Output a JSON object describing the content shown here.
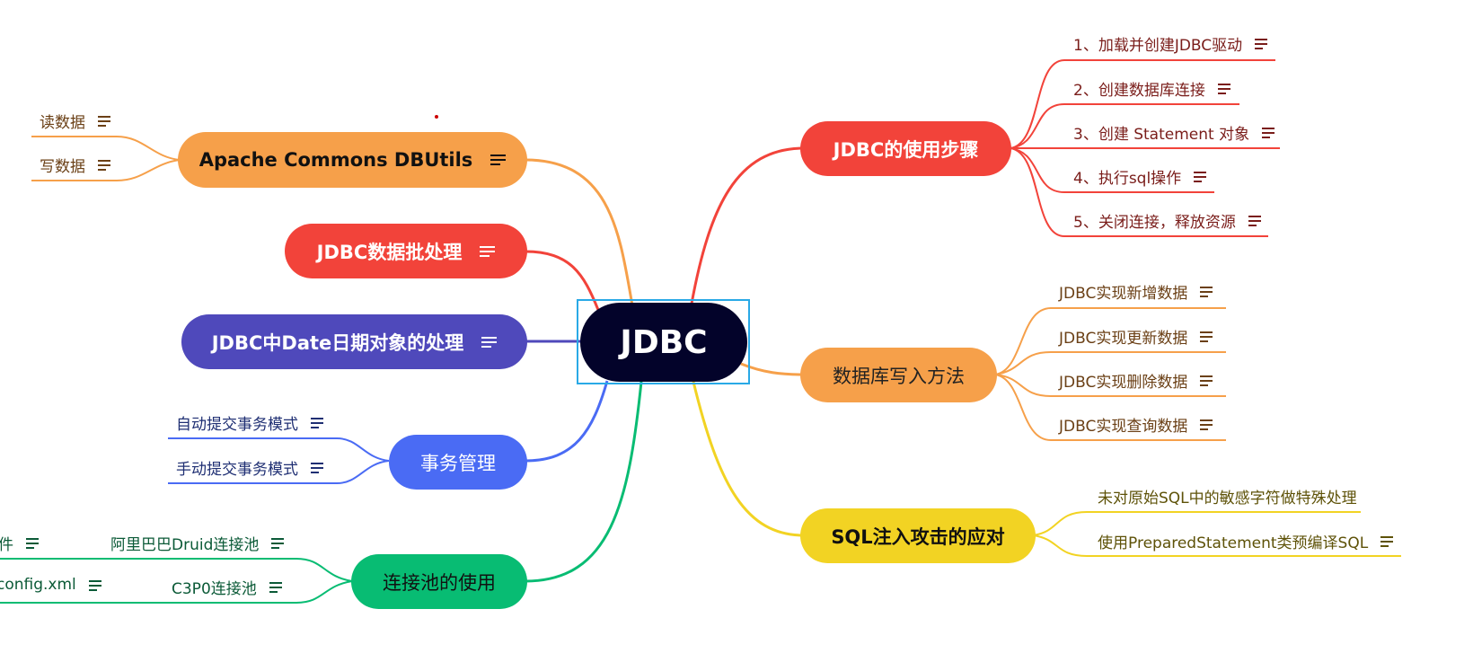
{
  "root": {
    "label": "JDBC",
    "color": "#03032a"
  },
  "branches": {
    "steps": {
      "label": "JDBC的使用步骤",
      "color": "#f2433a",
      "leaves": [
        "1、加载并创建JDBC驱动",
        "2、创建数据库连接",
        "3、创建 Statement 对象",
        "4、执行sql操作",
        "5、关闭连接，释放资源"
      ]
    },
    "write": {
      "label": "数据库写入方法",
      "color": "#f6a04a",
      "leaves": [
        "JDBC实现新增数据",
        "JDBC实现更新数据",
        "JDBC实现删除数据",
        "JDBC实现查询数据"
      ]
    },
    "sql": {
      "label": "SQL注入攻击的应对",
      "color": "#f2d323",
      "leaves": [
        "未对原始SQL中的敏感字符做特殊处理",
        "使用PreparedStatement类预编译SQL"
      ]
    },
    "dbutils": {
      "label": "Apache Commons DBUtils",
      "color": "#f6a04a",
      "leaves": [
        "读数据",
        "写数据"
      ]
    },
    "batch": {
      "label": "JDBC数据批处理",
      "color": "#f2433a"
    },
    "date": {
      "label": "JDBC中Date日期对象的处理",
      "color": "#4f49bb"
    },
    "tx": {
      "label": "事务管理",
      "color": "#4a6bf4",
      "leaves": [
        "自动提交事务模式",
        "手动提交事务模式"
      ]
    },
    "pool": {
      "label": "连接池的使用",
      "color": "#08bc73",
      "leaves": [
        "阿里巴巴Druid连接池",
        "C3P0连接池"
      ],
      "far_leaves": [
        "件",
        "config.xml"
      ]
    }
  },
  "decor": {
    "selection_color": "#29a9e6",
    "dot_color": "#cc0000"
  }
}
